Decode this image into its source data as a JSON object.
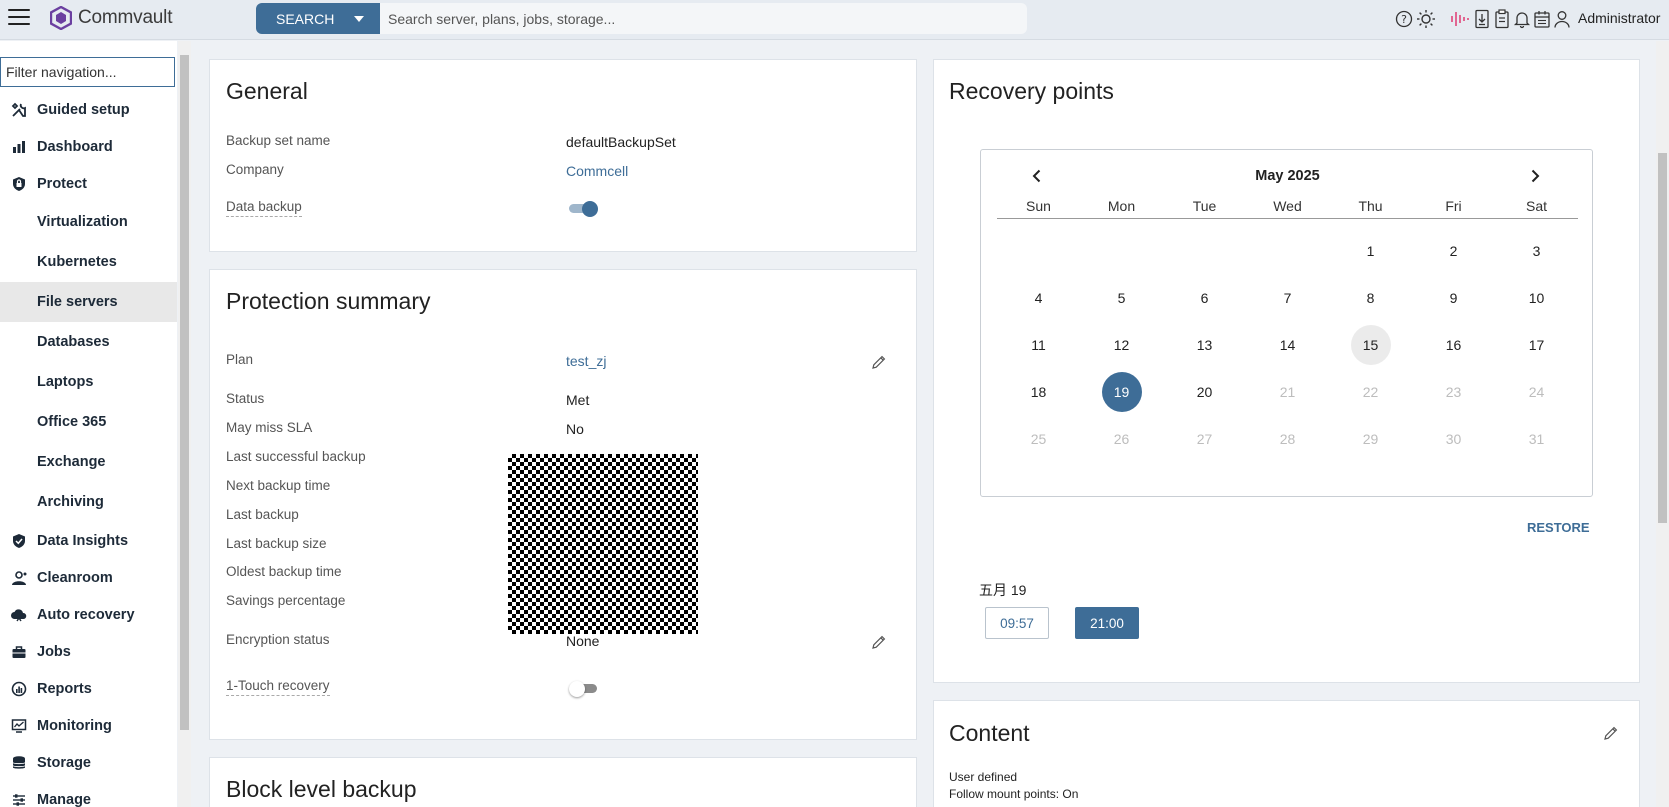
{
  "header": {
    "brand": "Commvault",
    "search_button": "SEARCH",
    "search_placeholder": "Search server, plans, jobs, storage...",
    "user": "Administrator"
  },
  "sidebar": {
    "filter_placeholder": "Filter navigation...",
    "items": [
      {
        "label": "Guided setup",
        "icon": "tools-icon"
      },
      {
        "label": "Dashboard",
        "icon": "dashboard-icon"
      },
      {
        "label": "Protect",
        "icon": "shield-lock-icon"
      },
      {
        "label": "Virtualization"
      },
      {
        "label": "Kubernetes"
      },
      {
        "label": "File servers",
        "active": true
      },
      {
        "label": "Databases"
      },
      {
        "label": "Laptops"
      },
      {
        "label": "Office 365"
      },
      {
        "label": "Exchange"
      },
      {
        "label": "Archiving"
      },
      {
        "label": "Data Insights",
        "icon": "shield-check-icon"
      },
      {
        "label": "Cleanroom",
        "icon": "cleanroom-icon"
      },
      {
        "label": "Auto recovery",
        "icon": "cloud-icon"
      },
      {
        "label": "Jobs",
        "icon": "briefcase-icon"
      },
      {
        "label": "Reports",
        "icon": "reports-icon"
      },
      {
        "label": "Monitoring",
        "icon": "monitor-icon"
      },
      {
        "label": "Storage",
        "icon": "database-icon"
      },
      {
        "label": "Manage",
        "icon": "sliders-icon"
      }
    ]
  },
  "general": {
    "title": "General",
    "backup_set_name_label": "Backup set name",
    "backup_set_name": "defaultBackupSet",
    "company_label": "Company",
    "company": "Commcell",
    "data_backup_label": "Data backup",
    "data_backup_enabled": true
  },
  "protection": {
    "title": "Protection summary",
    "plan_label": "Plan",
    "plan": "test_zj",
    "status_label": "Status",
    "status": "Met",
    "miss_sla_label": "May miss SLA",
    "miss_sla": "No",
    "last_success_label": "Last successful backup",
    "next_backup_label": "Next backup time",
    "last_backup_label": "Last backup",
    "last_size_label": "Last backup size",
    "oldest_label": "Oldest backup time",
    "savings_label": "Savings percentage",
    "encryption_label": "Encryption status",
    "encryption": "None",
    "one_touch_label": "1-Touch recovery",
    "one_touch_enabled": false
  },
  "block_level": {
    "title": "Block level backup"
  },
  "recovery": {
    "title": "Recovery points",
    "month": "May 2025",
    "weekdays": [
      "Sun",
      "Mon",
      "Tue",
      "Wed",
      "Thu",
      "Fri",
      "Sat"
    ],
    "days": [
      "1",
      "2",
      "3",
      "4",
      "5",
      "6",
      "7",
      "8",
      "9",
      "10",
      "11",
      "12",
      "13",
      "14",
      "15",
      "16",
      "17",
      "18",
      "19",
      "20",
      "21",
      "22",
      "23",
      "24",
      "25",
      "26",
      "27",
      "28",
      "29",
      "30",
      "31"
    ],
    "first_weekday": 4,
    "today": 15,
    "selected": 19,
    "last_available": 20,
    "restore_label": "RESTORE",
    "selected_date_label": "五月 19",
    "times": [
      "09:57",
      "21:00"
    ],
    "selected_time": "21:00"
  },
  "content": {
    "title": "Content",
    "line1": "User defined",
    "line2": "Follow mount points: On"
  },
  "colors": {
    "accent": "#3e6d97",
    "muted_day": "#bdbdbd",
    "today_bg": "#ebebeb"
  }
}
